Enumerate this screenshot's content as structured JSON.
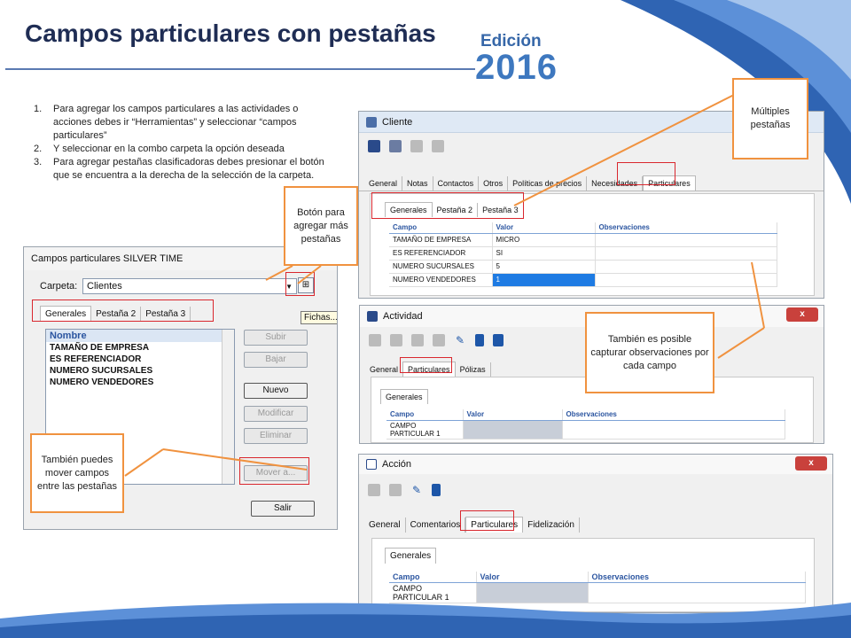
{
  "slide": {
    "title": "Campos particulares con pestañas",
    "edition_label": "Edición",
    "edition_year": "2016",
    "colors": {
      "title": "#1f2d54",
      "accent": "#3e78bf",
      "callout_border": "#f0923f",
      "highlight": "#d9272e"
    }
  },
  "instructions": [
    {
      "num": "1.",
      "text": "Para agregar los campos particulares a las actividades o acciones debes ir “Herramientas” y seleccionar “campos particulares”"
    },
    {
      "num": "2.",
      "text": "Y seleccionar en la combo carpeta la opción deseada"
    },
    {
      "num": "3.",
      "text": "Para agregar pestañas clasificadoras debes presionar el botón que se encuentra a la derecha de la selección de la carpeta."
    }
  ],
  "callouts": {
    "add_tab": "Botón para agregar más pestañas",
    "multiple_tabs": "Múltiples pestañas",
    "observations": "También es posible capturar observaciones por cada campo",
    "move_fields": "También puedes mover campos entre las pestañas"
  },
  "campos_dialog": {
    "title": "Campos particulares SILVER TIME",
    "folder_label": "Carpeta:",
    "folder_value": "Clientes",
    "tooltip": "Fichas...",
    "tabs": [
      "Generales",
      "Pestaña 2",
      "Pestaña 3"
    ],
    "list_header": "Nombre",
    "items": [
      "TAMAÑO DE EMPRESA",
      "ES REFERENCIADOR",
      "NUMERO SUCURSALES",
      "NUMERO VENDEDORES"
    ],
    "buttons": {
      "up": "Subir",
      "down": "Bajar",
      "new": "Nuevo",
      "modify": "Modificar",
      "delete": "Eliminar",
      "move": "Mover a...",
      "exit": "Salir"
    }
  },
  "cliente_window": {
    "title": "Cliente",
    "tabs": [
      "General",
      "Notas",
      "Contactos",
      "Otros",
      "Políticas de precios",
      "Necesidades",
      "Particulares"
    ],
    "subtabs": [
      "Generales",
      "Pestaña 2",
      "Pestaña 3"
    ],
    "columns": [
      "Campo",
      "Valor",
      "Observaciones"
    ],
    "rows": [
      [
        "TAMAÑO DE EMPRESA",
        "MICRO",
        ""
      ],
      [
        "ES REFERENCIADOR",
        "SI",
        ""
      ],
      [
        "NUMERO SUCURSALES",
        "5",
        ""
      ],
      [
        "NUMERO VENDEDORES",
        "1",
        ""
      ]
    ]
  },
  "actividad_window": {
    "title": "Actividad",
    "close": "x",
    "tabs": [
      "General",
      "Particulares",
      "Pólizas"
    ],
    "subtabs": [
      "Generales"
    ],
    "columns": [
      "Campo",
      "Valor",
      "Observaciones"
    ],
    "rows": [
      [
        "CAMPO PARTICULAR 1",
        "",
        ""
      ]
    ]
  },
  "accion_window": {
    "title": "Acción",
    "close": "x",
    "tabs": [
      "General",
      "Comentarios",
      "Particulares",
      "Fidelización"
    ],
    "subtabs": [
      "Generales"
    ],
    "columns": [
      "Campo",
      "Valor",
      "Observaciones"
    ],
    "rows": [
      [
        "CAMPO PARTICULAR 1",
        "",
        ""
      ]
    ]
  }
}
